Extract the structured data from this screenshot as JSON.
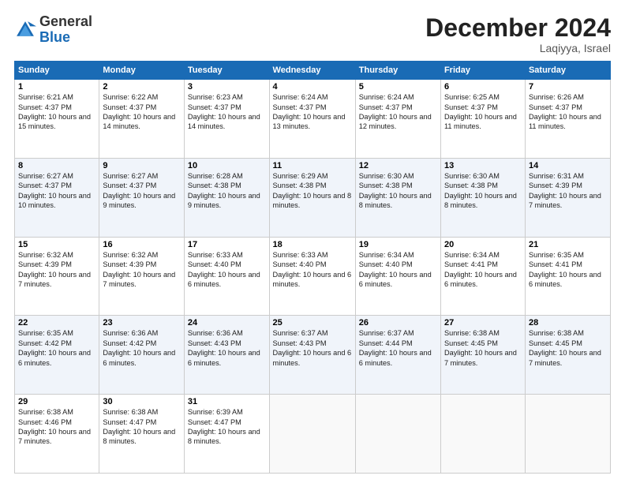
{
  "header": {
    "logo_general": "General",
    "logo_blue": "Blue",
    "month_title": "December 2024",
    "subtitle": "Laqiyya, Israel"
  },
  "days_of_week": [
    "Sunday",
    "Monday",
    "Tuesday",
    "Wednesday",
    "Thursday",
    "Friday",
    "Saturday"
  ],
  "weeks": [
    [
      {
        "day": 1,
        "sunrise": "6:21 AM",
        "sunset": "4:37 PM",
        "daylight": "10 hours and 15 minutes."
      },
      {
        "day": 2,
        "sunrise": "6:22 AM",
        "sunset": "4:37 PM",
        "daylight": "10 hours and 14 minutes."
      },
      {
        "day": 3,
        "sunrise": "6:23 AM",
        "sunset": "4:37 PM",
        "daylight": "10 hours and 14 minutes."
      },
      {
        "day": 4,
        "sunrise": "6:24 AM",
        "sunset": "4:37 PM",
        "daylight": "10 hours and 13 minutes."
      },
      {
        "day": 5,
        "sunrise": "6:24 AM",
        "sunset": "4:37 PM",
        "daylight": "10 hours and 12 minutes."
      },
      {
        "day": 6,
        "sunrise": "6:25 AM",
        "sunset": "4:37 PM",
        "daylight": "10 hours and 11 minutes."
      },
      {
        "day": 7,
        "sunrise": "6:26 AM",
        "sunset": "4:37 PM",
        "daylight": "10 hours and 11 minutes."
      }
    ],
    [
      {
        "day": 8,
        "sunrise": "6:27 AM",
        "sunset": "4:37 PM",
        "daylight": "10 hours and 10 minutes."
      },
      {
        "day": 9,
        "sunrise": "6:27 AM",
        "sunset": "4:37 PM",
        "daylight": "10 hours and 9 minutes."
      },
      {
        "day": 10,
        "sunrise": "6:28 AM",
        "sunset": "4:38 PM",
        "daylight": "10 hours and 9 minutes."
      },
      {
        "day": 11,
        "sunrise": "6:29 AM",
        "sunset": "4:38 PM",
        "daylight": "10 hours and 8 minutes."
      },
      {
        "day": 12,
        "sunrise": "6:30 AM",
        "sunset": "4:38 PM",
        "daylight": "10 hours and 8 minutes."
      },
      {
        "day": 13,
        "sunrise": "6:30 AM",
        "sunset": "4:38 PM",
        "daylight": "10 hours and 8 minutes."
      },
      {
        "day": 14,
        "sunrise": "6:31 AM",
        "sunset": "4:39 PM",
        "daylight": "10 hours and 7 minutes."
      }
    ],
    [
      {
        "day": 15,
        "sunrise": "6:32 AM",
        "sunset": "4:39 PM",
        "daylight": "10 hours and 7 minutes."
      },
      {
        "day": 16,
        "sunrise": "6:32 AM",
        "sunset": "4:39 PM",
        "daylight": "10 hours and 7 minutes."
      },
      {
        "day": 17,
        "sunrise": "6:33 AM",
        "sunset": "4:40 PM",
        "daylight": "10 hours and 6 minutes."
      },
      {
        "day": 18,
        "sunrise": "6:33 AM",
        "sunset": "4:40 PM",
        "daylight": "10 hours and 6 minutes."
      },
      {
        "day": 19,
        "sunrise": "6:34 AM",
        "sunset": "4:40 PM",
        "daylight": "10 hours and 6 minutes."
      },
      {
        "day": 20,
        "sunrise": "6:34 AM",
        "sunset": "4:41 PM",
        "daylight": "10 hours and 6 minutes."
      },
      {
        "day": 21,
        "sunrise": "6:35 AM",
        "sunset": "4:41 PM",
        "daylight": "10 hours and 6 minutes."
      }
    ],
    [
      {
        "day": 22,
        "sunrise": "6:35 AM",
        "sunset": "4:42 PM",
        "daylight": "10 hours and 6 minutes."
      },
      {
        "day": 23,
        "sunrise": "6:36 AM",
        "sunset": "4:42 PM",
        "daylight": "10 hours and 6 minutes."
      },
      {
        "day": 24,
        "sunrise": "6:36 AM",
        "sunset": "4:43 PM",
        "daylight": "10 hours and 6 minutes."
      },
      {
        "day": 25,
        "sunrise": "6:37 AM",
        "sunset": "4:43 PM",
        "daylight": "10 hours and 6 minutes."
      },
      {
        "day": 26,
        "sunrise": "6:37 AM",
        "sunset": "4:44 PM",
        "daylight": "10 hours and 6 minutes."
      },
      {
        "day": 27,
        "sunrise": "6:38 AM",
        "sunset": "4:45 PM",
        "daylight": "10 hours and 7 minutes."
      },
      {
        "day": 28,
        "sunrise": "6:38 AM",
        "sunset": "4:45 PM",
        "daylight": "10 hours and 7 minutes."
      }
    ],
    [
      {
        "day": 29,
        "sunrise": "6:38 AM",
        "sunset": "4:46 PM",
        "daylight": "10 hours and 7 minutes."
      },
      {
        "day": 30,
        "sunrise": "6:38 AM",
        "sunset": "4:47 PM",
        "daylight": "10 hours and 8 minutes."
      },
      {
        "day": 31,
        "sunrise": "6:39 AM",
        "sunset": "4:47 PM",
        "daylight": "10 hours and 8 minutes."
      },
      null,
      null,
      null,
      null
    ]
  ]
}
